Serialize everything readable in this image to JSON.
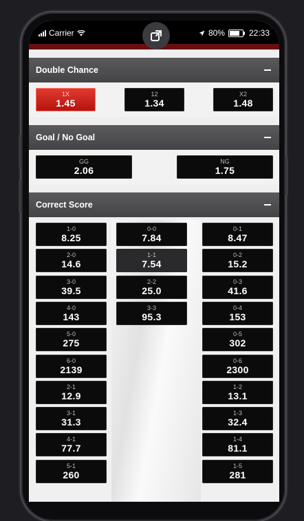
{
  "status": {
    "carrier": "Carrier",
    "battery": "80%",
    "time": "22:33"
  },
  "sections": [
    {
      "title": "Double Chance",
      "options": [
        {
          "label": "1X",
          "odd": "1.45",
          "selected": true
        },
        {
          "label": "12",
          "odd": "1.34",
          "selected": false
        },
        {
          "label": "X2",
          "odd": "1.48",
          "selected": false
        }
      ]
    },
    {
      "title": "Goal / No Goal",
      "options": [
        {
          "label": "GG",
          "odd": "2.06"
        },
        {
          "label": "NG",
          "odd": "1.75"
        }
      ]
    },
    {
      "title": "Correct Score",
      "home": [
        {
          "label": "1-0",
          "odd": "8.25"
        },
        {
          "label": "2-0",
          "odd": "14.6"
        },
        {
          "label": "3-0",
          "odd": "39.5"
        },
        {
          "label": "4-0",
          "odd": "143"
        },
        {
          "label": "5-0",
          "odd": "275"
        },
        {
          "label": "6-0",
          "odd": "2139"
        },
        {
          "label": "2-1",
          "odd": "12.9"
        },
        {
          "label": "3-1",
          "odd": "31.3"
        },
        {
          "label": "4-1",
          "odd": "77.7"
        },
        {
          "label": "5-1",
          "odd": "260"
        }
      ],
      "draw": [
        {
          "label": "0-0",
          "odd": "7.84"
        },
        {
          "label": "1-1",
          "odd": "7.54"
        },
        {
          "label": "2-2",
          "odd": "25.0"
        },
        {
          "label": "3-3",
          "odd": "95.3"
        }
      ],
      "away": [
        {
          "label": "0-1",
          "odd": "8.47"
        },
        {
          "label": "0-2",
          "odd": "15.2"
        },
        {
          "label": "0-3",
          "odd": "41.6"
        },
        {
          "label": "0-4",
          "odd": "153"
        },
        {
          "label": "0-5",
          "odd": "302"
        },
        {
          "label": "0-6",
          "odd": "2300"
        },
        {
          "label": "1-2",
          "odd": "13.1"
        },
        {
          "label": "1-3",
          "odd": "32.4"
        },
        {
          "label": "1-4",
          "odd": "81.1"
        },
        {
          "label": "1-5",
          "odd": "281"
        }
      ]
    }
  ]
}
